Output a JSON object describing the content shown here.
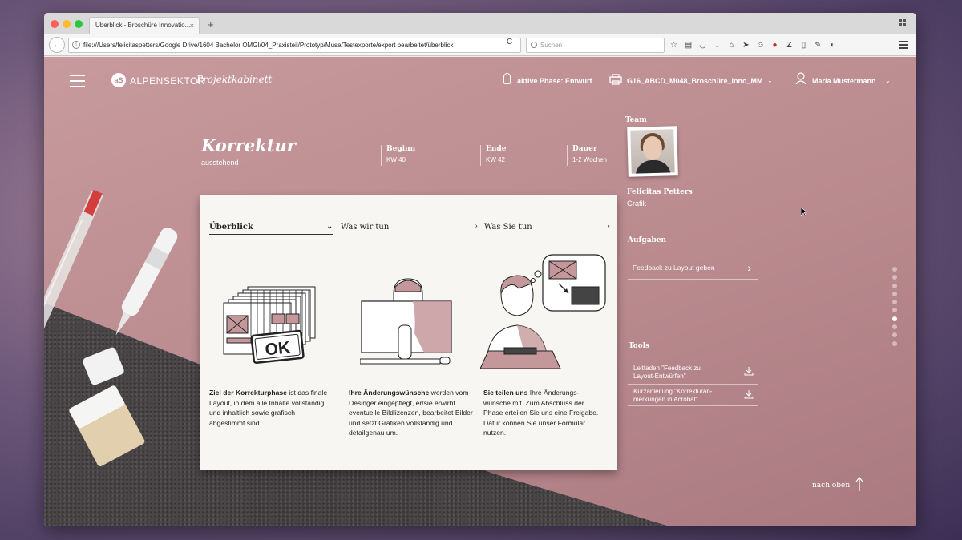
{
  "browser": {
    "tab_title": "Überblick - Broschüre Innovatio...",
    "tab_close": "×",
    "new_tab": "+",
    "back": "←",
    "url": "file:///Users/felicitaspetters/Google Drive/1604 Bachelor OMGI/04_Praxisteil/Prototyp/Muse/Testexporte/export bearbeitet/überblick",
    "reload": "C",
    "search_placeholder": "Suchen",
    "toolbar_icons": [
      "star-icon",
      "bookmarks-icon",
      "pocket-icon",
      "download-icon",
      "home-icon",
      "send-icon",
      "smiley-icon",
      "pinterest-icon",
      "zotero-icon",
      "page-icon",
      "pen-icon",
      "dark-icon"
    ]
  },
  "header": {
    "brand": "ALPENSEKTOR",
    "brand_sub": "Projektkabinett",
    "phase": "aktive Phase: Entwurf",
    "project": "G16_ABCD_M048_Broschüre_Inno_MM",
    "user": "Maria Mustermann"
  },
  "phase": {
    "title": "Korrektur",
    "status": "ausstehend",
    "meta": [
      {
        "label": "Beginn",
        "value": "KW 40"
      },
      {
        "label": "Ende",
        "value": "KW 42"
      },
      {
        "label": "Dauer",
        "value": "1-2 Wochen"
      }
    ]
  },
  "card": {
    "tabs": [
      {
        "label": "Überblick",
        "arrow": "⌄"
      },
      {
        "label": "Was wir tun",
        "arrow": "›"
      },
      {
        "label": "Was Sie tun",
        "arrow": "›"
      }
    ],
    "ok_label": "OK",
    "columns": [
      {
        "bold": "Ziel der Korrekturphase",
        "text": " ist das finale Layout, in dem alle Inhalte vollständig und inhaltlich sowie grafisch abgestimmt sind."
      },
      {
        "bold": "Ihre Änderungswünsche",
        "text": " werden vom Desinger eingepflegt, er/sie erwirbt eventuelle Bildlizenzen, bearbeitet Bilder und setzt Grafiken vollständig und detailgenau um."
      },
      {
        "bold": "Sie teilen uns",
        "text": " Ihre Änderungs-wünsche mit. Zum Abschluss der Phase erteilen Sie uns eine Freigabe. Dafür können Sie unser Formular nutzen."
      }
    ]
  },
  "sidebar": {
    "team_label": "Team",
    "member_name": "Felicitas Petters",
    "member_role": "Grafik",
    "tasks_label": "Aufgaben",
    "task": "Feedback zu Layout geben",
    "tools_label": "Tools",
    "tools": [
      {
        "line1": "Leitfaden \"Feedback zu",
        "line2": "Layout-Entwürfen\""
      },
      {
        "line1": "Kurzanleitung \"Korrekturan-",
        "line2": "merkungen in Acrobat\""
      }
    ]
  },
  "pager": {
    "count": 10,
    "active_index": 6
  },
  "back_to_top": "nach oben",
  "colors": {
    "page_bg": "#b98a8e",
    "accent": "#c4989b",
    "card_bg": "#f7f6f3",
    "granite": "#4a4648"
  }
}
